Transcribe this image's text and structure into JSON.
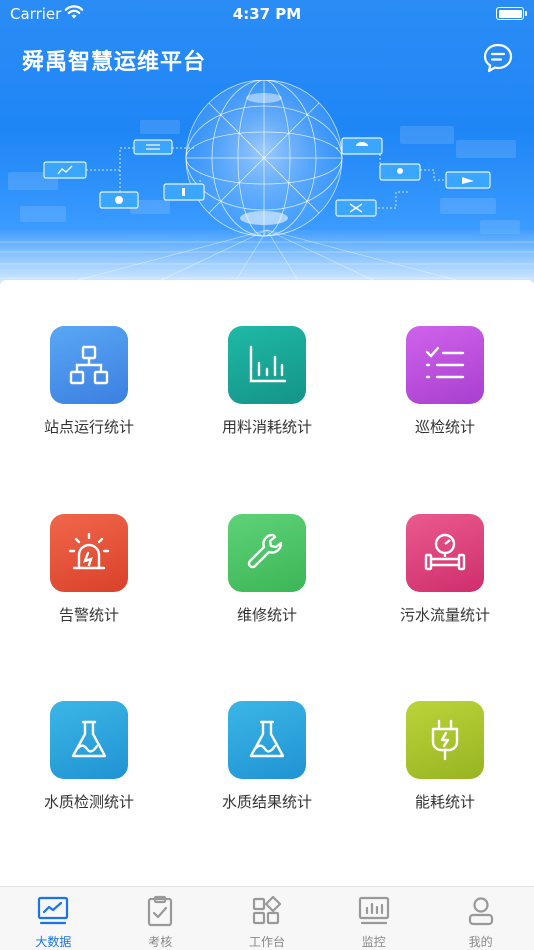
{
  "status_bar": {
    "carrier": "Carrier",
    "time": "4:37 PM"
  },
  "header": {
    "title": "舜禹智慧运维平台",
    "chat_icon": "chat-bubble-icon"
  },
  "features": [
    {
      "label": "站点运行统计",
      "icon": "sitemap-icon",
      "colors": [
        "#5aa7f5",
        "#3b7fe0"
      ]
    },
    {
      "label": "用料消耗统计",
      "icon": "bar-chart-icon",
      "colors": [
        "#1fb9a6",
        "#149488"
      ]
    },
    {
      "label": "巡检统计",
      "icon": "checklist-icon",
      "colors": [
        "#cf63ec",
        "#a93fcf"
      ]
    },
    {
      "label": "告警统计",
      "icon": "alarm-icon",
      "colors": [
        "#f0674b",
        "#d9412a"
      ]
    },
    {
      "label": "维修统计",
      "icon": "wrench-icon",
      "colors": [
        "#5fd277",
        "#3bb657"
      ]
    },
    {
      "label": "污水流量统计",
      "icon": "flowmeter-icon",
      "colors": [
        "#ea5a8e",
        "#cf2e6c"
      ]
    },
    {
      "label": "水质检测统计",
      "icon": "flask-icon",
      "colors": [
        "#3bb6e6",
        "#2093d3"
      ]
    },
    {
      "label": "水质结果统计",
      "icon": "flask-icon",
      "colors": [
        "#3bb6e6",
        "#2093d3"
      ]
    },
    {
      "label": "能耗统计",
      "icon": "plug-icon",
      "colors": [
        "#bcd43b",
        "#97b421"
      ]
    }
  ],
  "tabs": [
    {
      "label": "大数据",
      "icon": "trend-monitor-icon",
      "active": true
    },
    {
      "label": "考核",
      "icon": "clipboard-check-icon",
      "active": false
    },
    {
      "label": "工作台",
      "icon": "apps-grid-icon",
      "active": false
    },
    {
      "label": "监控",
      "icon": "monitor-bars-icon",
      "active": false
    },
    {
      "label": "我的",
      "icon": "user-icon",
      "active": false
    }
  ],
  "colors": {
    "accent": "#1a73e8",
    "banner": "#2b8cf5"
  }
}
